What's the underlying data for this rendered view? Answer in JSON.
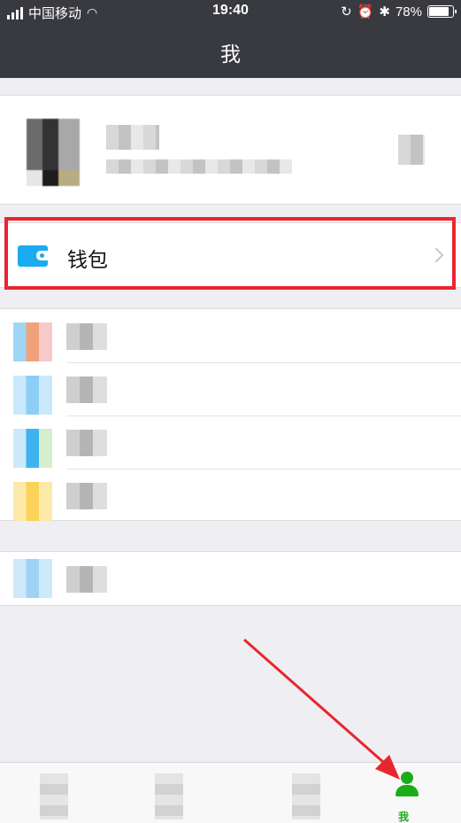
{
  "status_bar": {
    "carrier": "中国移动",
    "time": "19:40",
    "battery": "78%"
  },
  "nav": {
    "title": "我"
  },
  "wallet": {
    "label": "钱包",
    "icon": "wallet-icon"
  },
  "tab_bar": {
    "me_label": "我"
  },
  "colors": {
    "nav_bg": "#393a3f",
    "highlight": "#e8262d",
    "accent_green": "#1aad19",
    "wallet_blue": "#1aabf1"
  }
}
